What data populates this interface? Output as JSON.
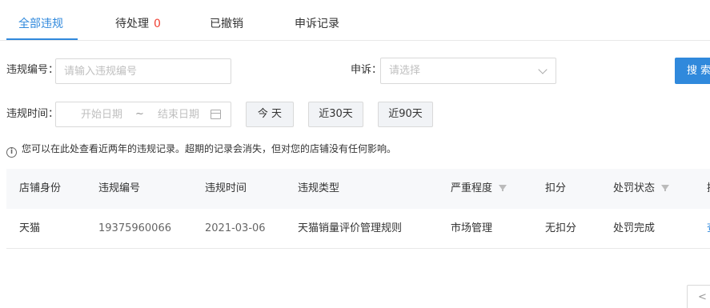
{
  "tabs": [
    {
      "label": "全部违规"
    },
    {
      "label": "待处理",
      "count": "0"
    },
    {
      "label": "已撤销"
    },
    {
      "label": "申诉记录"
    }
  ],
  "filters": {
    "violation_no_label": "违规编号：",
    "violation_no_placeholder": "请输入违规编号",
    "appeal_label": "申诉：",
    "appeal_placeholder": "请选择",
    "search_button": "搜索",
    "time_label": "违规时间：",
    "start_placeholder": "开始日期",
    "range_separator": "~",
    "end_placeholder": "结束日期",
    "quick_today": "今 天",
    "quick_30": "近30天",
    "quick_90": "近90天"
  },
  "tip": "您可以在此处查看近两年的违规记录。超期的记录会消失，但对您的店铺没有任何影响。",
  "table": {
    "headers": [
      "店铺身份",
      "违规编号",
      "违规时间",
      "违规类型",
      "严重程度",
      "扣分",
      "处罚状态",
      "操"
    ],
    "rows": [
      [
        "天猫",
        "19375960066",
        "2021-03-06",
        "天猫销量评价管理规则",
        "市场管理",
        "无扣分",
        "处罚完成",
        "查"
      ]
    ]
  },
  "pager": {
    "prev": "<"
  },
  "colors": {
    "accent": "#3089dc",
    "count": "#f04134"
  }
}
